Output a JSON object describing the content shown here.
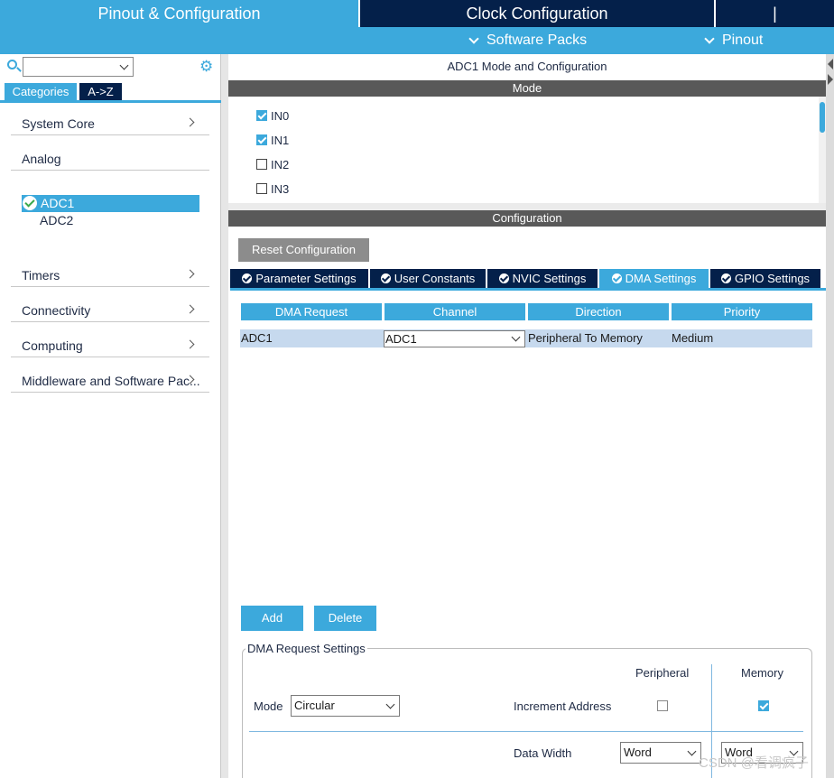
{
  "top_tabs": {
    "pinout_config": "Pinout & Configuration",
    "clock_config": "Clock Configuration",
    "extra": "|"
  },
  "sub_menu": {
    "software_packs": "Software Packs",
    "pinout": "Pinout"
  },
  "left": {
    "search_value": "",
    "tabs": {
      "categories": "Categories",
      "az": "A->Z"
    },
    "categories": [
      {
        "label": "System Core",
        "has_arrow": true
      },
      {
        "label": "Analog",
        "has_arrow": false
      },
      {
        "label": "Timers",
        "has_arrow": true
      },
      {
        "label": "Connectivity",
        "has_arrow": true
      },
      {
        "label": "Computing",
        "has_arrow": true
      },
      {
        "label": "Middleware and Software Pac...",
        "has_arrow": true
      }
    ],
    "analog_items": {
      "adc1": "ADC1",
      "adc2": "ADC2"
    }
  },
  "main": {
    "title": "ADC1 Mode and Configuration",
    "mode_header": "Mode",
    "mode_items": [
      {
        "label": "IN0",
        "checked": true
      },
      {
        "label": "IN1",
        "checked": true
      },
      {
        "label": "IN2",
        "checked": false
      },
      {
        "label": "IN3",
        "checked": false
      }
    ],
    "config_header": "Configuration",
    "reset_button": "Reset Configuration",
    "config_tabs": [
      {
        "label": "Parameter Settings",
        "active": false
      },
      {
        "label": "User Constants",
        "active": false
      },
      {
        "label": "NVIC Settings",
        "active": false
      },
      {
        "label": "DMA Settings",
        "active": true
      },
      {
        "label": "GPIO Settings",
        "active": false
      }
    ],
    "dma_table": {
      "headers": [
        "DMA Request",
        "Channel",
        "Direction",
        "Priority"
      ],
      "rows": [
        {
          "request": "ADC1",
          "channel": "ADC1",
          "direction": "Peripheral To Memory",
          "priority": "Medium"
        }
      ]
    },
    "add_button": "Add",
    "delete_button": "Delete",
    "dma_request_settings": {
      "legend": "DMA Request Settings",
      "peripheral_header": "Peripheral",
      "memory_header": "Memory",
      "mode_label": "Mode",
      "mode_value": "Circular",
      "increment_label": "Increment Address",
      "increment_peripheral": false,
      "increment_memory": true,
      "data_width_label": "Data Width",
      "data_width_peripheral": "Word",
      "data_width_memory": "Word"
    }
  },
  "watermark": "CSDN @看调疯子",
  "colors": {
    "accent": "#3ca9dc",
    "navy": "#04204a",
    "section_gray": "#595959",
    "row_highlight": "#c6d9ee"
  }
}
